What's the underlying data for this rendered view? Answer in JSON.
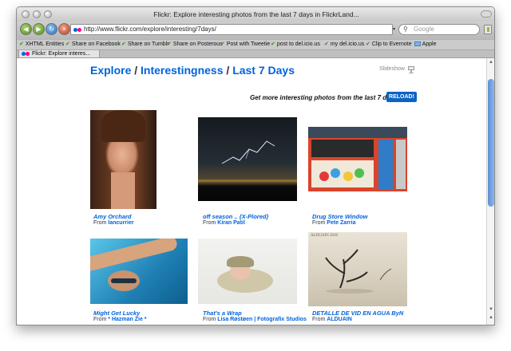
{
  "window": {
    "title": "Flickr: Explore interesting photos from the last 7 days in FlickrLand...",
    "url": "http://www.flickr.com/explore/interesting/7days/",
    "search_placeholder": "Google"
  },
  "bookmarks": [
    "XHTML Entities",
    "Share on Facebook",
    "Share on Tumblr",
    "Share on Posterous",
    "Post with Tweetie",
    "post to del.icio.us",
    "my del.icio.us",
    "Clip to Evernote",
    "Apple"
  ],
  "tab": {
    "label": "Flickr: Explore interes..."
  },
  "page": {
    "crumbs": [
      "Explore",
      "Interestingness",
      "Last 7 Days"
    ],
    "separator": " / ",
    "slideshow_label": "Slideshow",
    "promo_text": "Get more interesting photos from the last 7 days",
    "reload_label": "RELOAD!",
    "from_label": "From"
  },
  "photos": [
    {
      "title": "Amy Orchard",
      "author": "lancurrier"
    },
    {
      "title": "off season .. {X-Plored}",
      "author": "Kiran Patil"
    },
    {
      "title": "Drug Store Window",
      "author": "Pete Zarria"
    },
    {
      "title": "Might Get Lucky",
      "author": "* Hazman Zie *"
    },
    {
      "title": "That's a Wrap",
      "author": "Lisa Røstøen | Fotografix Studios"
    },
    {
      "title": "DETALLE DE VID EN AGUA ByN",
      "author": "ALDUAIN",
      "watermark": "ALDUAIN 2010"
    }
  ],
  "colors": {
    "link": "#0063dc",
    "reload_button": "#0a64c8",
    "flickr_pink": "#ff0084",
    "flickr_blue": "#0063dc"
  }
}
